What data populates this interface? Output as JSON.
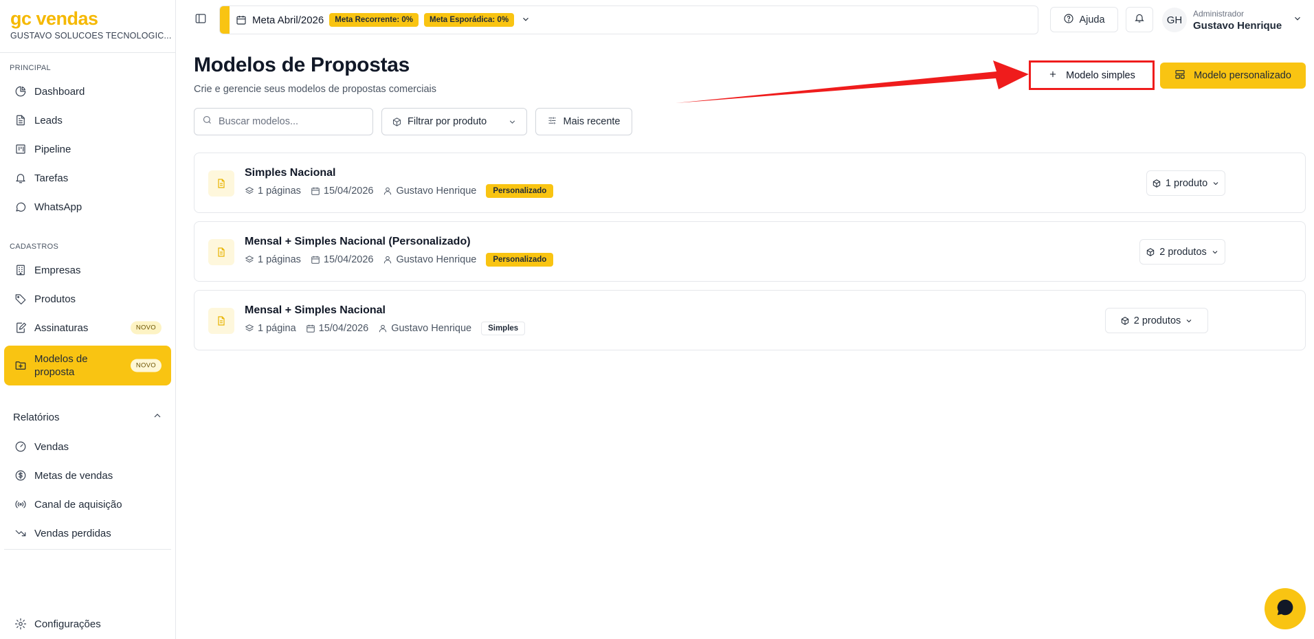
{
  "brand": {
    "logo": "gc vendas",
    "company": "GUSTAVO SOLUCOES TECNOLOGIC..."
  },
  "sidebar": {
    "section_principal": "PRINCIPAL",
    "principal_items": [
      {
        "label": "Dashboard",
        "icon": "pie-chart-icon"
      },
      {
        "label": "Leads",
        "icon": "file-text-icon"
      },
      {
        "label": "Pipeline",
        "icon": "kanban-icon"
      },
      {
        "label": "Tarefas",
        "icon": "bell-icon"
      },
      {
        "label": "WhatsApp",
        "icon": "chat-bubble-icon"
      }
    ],
    "section_cadastros": "CADASTROS",
    "cadastro_items": [
      {
        "label": "Empresas",
        "icon": "building-icon"
      },
      {
        "label": "Produtos",
        "icon": "tag-icon"
      },
      {
        "label": "Assinaturas",
        "icon": "signature-icon",
        "badge": "NOVO"
      },
      {
        "label": "Modelos de proposta",
        "icon": "folder-plus-icon",
        "badge": "NOVO",
        "active": true
      }
    ],
    "relatorios_label": "Relatórios",
    "relatorio_items": [
      {
        "label": "Vendas",
        "icon": "gauge-icon"
      },
      {
        "label": "Metas de vendas",
        "icon": "dollar-circle-icon"
      },
      {
        "label": "Canal de aquisição",
        "icon": "broadcast-icon"
      },
      {
        "label": "Vendas perdidas",
        "icon": "trending-down-icon"
      }
    ],
    "settings_label": "Configurações"
  },
  "topbar": {
    "meta_title": "Meta Abril/2026",
    "meta_recorrente": "Meta Recorrente: 0%",
    "meta_esporadica": "Meta Esporádica: 0%",
    "help_label": "Ajuda",
    "user_initials": "GH",
    "user_role": "Administrador",
    "user_name": "Gustavo Henrique"
  },
  "page": {
    "title": "Modelos de Propostas",
    "subtitle": "Crie e gerencie seus modelos de propostas comerciais",
    "btn_simple": "Modelo simples",
    "btn_custom": "Modelo personalizado",
    "search_placeholder": "Buscar modelos...",
    "filter_label": "Filtrar por produto",
    "sort_label": "Mais recente"
  },
  "models": [
    {
      "title": "Simples Nacional",
      "pages": "1 páginas",
      "date": "15/04/2026",
      "author": "Gustavo Henrique",
      "tag": "Personalizado",
      "tag_type": "pers",
      "products": "1 produto"
    },
    {
      "title": "Mensal + Simples Nacional (Personalizado)",
      "pages": "1 páginas",
      "date": "15/04/2026",
      "author": "Gustavo Henrique",
      "tag": "Personalizado",
      "tag_type": "pers",
      "products": "2 produtos"
    },
    {
      "title": "Mensal + Simples Nacional",
      "pages": "1 página",
      "date": "15/04/2026",
      "author": "Gustavo Henrique",
      "tag": "Simples",
      "tag_type": "simp",
      "products": "2 produtos"
    }
  ],
  "colors": {
    "accent": "#f9c412",
    "annotation": "#ef1c1c"
  }
}
